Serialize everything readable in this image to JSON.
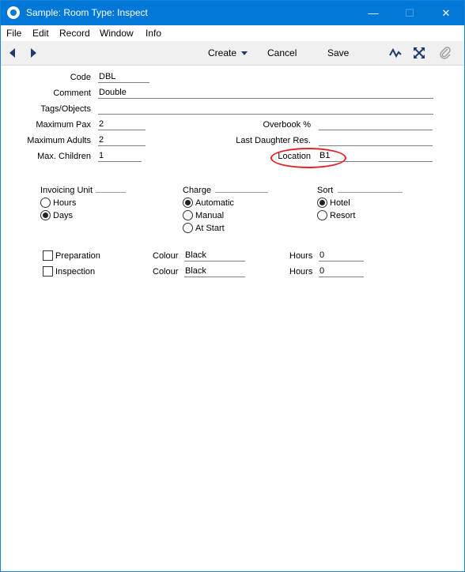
{
  "window": {
    "title": "Sample: Room Type: Inspect",
    "minimize_label": "—",
    "maximize_label": "☐",
    "close_label": "✕"
  },
  "menu": [
    "File",
    "Edit",
    "Record",
    "Window",
    "Info"
  ],
  "toolbar": {
    "create_label": "Create",
    "cancel_label": "Cancel",
    "save_label": "Save"
  },
  "icons": {
    "app": "app-logo-icon",
    "prev": "previous-record-icon",
    "next": "next-record-icon",
    "activity": "activity-icon",
    "fullscreen": "expand-icon",
    "attach": "paperclip-icon"
  },
  "colors": {
    "titlebar": "#0078d7",
    "highlight": "#e4242b"
  },
  "form": {
    "code": {
      "label": "Code",
      "value": "DBL"
    },
    "comment": {
      "label": "Comment",
      "value": "Double"
    },
    "tags": {
      "label": "Tags/Objects",
      "value": ""
    },
    "max_pax": {
      "label": "Maximum Pax",
      "value": "2"
    },
    "max_adults": {
      "label": "Maximum Adults",
      "value": "2"
    },
    "max_children": {
      "label": "Max. Children",
      "value": "1"
    },
    "overbook": {
      "label": "Overbook %",
      "value": ""
    },
    "last_daughter": {
      "label": "Last Daughter Res.",
      "value": ""
    },
    "location": {
      "label": "Location",
      "value": "B1"
    }
  },
  "invoicing_unit": {
    "title": "Invoicing Unit",
    "options": [
      "Hours",
      "Days"
    ],
    "selected": "Days"
  },
  "charge": {
    "title": "Charge",
    "options": [
      "Automatic",
      "Manual",
      "At Start"
    ],
    "selected": "Automatic"
  },
  "sort": {
    "title": "Sort",
    "options": [
      "Hotel",
      "Resort"
    ],
    "selected": "Hotel"
  },
  "tasks": [
    {
      "label": "Preparation",
      "checked": false,
      "colour_label": "Colour",
      "colour": "Black",
      "hours_label": "Hours",
      "hours": "0"
    },
    {
      "label": "Inspection",
      "checked": false,
      "colour_label": "Colour",
      "colour": "Black",
      "hours_label": "Hours",
      "hours": "0"
    }
  ]
}
